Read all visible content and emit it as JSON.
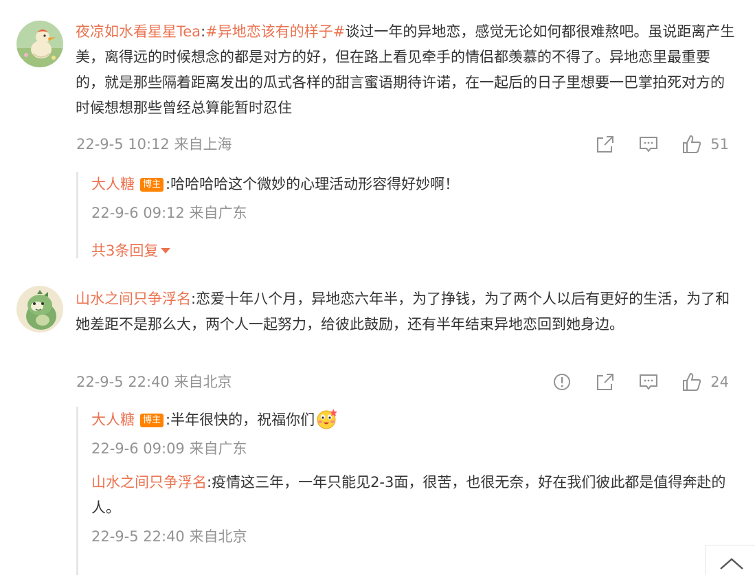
{
  "comments": [
    {
      "user": "夜凉如水看星星Tea",
      "sep": ":",
      "topic": "#异地恋该有的样子#",
      "text": "谈过一年的异地恋，感觉无论如何都很难熬吧。虽说距离产生美，离得远的时候想念的都是对方的好，但在路上看见牵手的情侣都羡慕的不得了。异地恋里最重要的，就是那些隔着距离发出的瓜式各样的甜言蜜语期待许诺，在一起后的日子里想要一巴掌拍死对方的时候想想那些曾经总算能暂时忍住",
      "time": "22-9-5 10:12 来自上海",
      "like_count": "51",
      "replies": [
        {
          "user": "大人糖",
          "badge": "博主",
          "text": ":哈哈哈哈这个微妙的心理活动形容得好妙啊！",
          "time": "22-9-6 09:12 来自广东"
        }
      ],
      "more_replies": "共3条回复"
    },
    {
      "user": "山水之间只争浮名",
      "sep": ":",
      "text": "恋爱十年八个月，异地恋六年半，为了挣钱，为了两个人以后有更好的生活，为了和她差距不是那么大，两个人一起努力，给彼此鼓励，还有半年结束异地恋回到她身边。",
      "time": "22-9-5 22:40 来自北京",
      "like_count": "24",
      "replies": [
        {
          "user": "大人糖",
          "badge": "博主",
          "text": ":半年很快的，祝福你们",
          "time": "22-9-6 09:09 来自广东"
        },
        {
          "user": "山水之间只争浮名",
          "text": ":疫情这三年，一年只能见2-3面，很苦，也很无奈，好在我们彼此都是值得奔赴的人。",
          "time": "22-9-5 22:40 来自北京"
        }
      ]
    }
  ],
  "icons": {
    "share": "share-icon",
    "comment": "comment-icon",
    "like": "thumbs-up-icon",
    "report": "report-icon",
    "back_to_top": "chevron-up-icon",
    "emoji": "blush-emoji-icon"
  },
  "colors": {
    "username": "#eb7350",
    "meta": "#939393",
    "badge": "#ff8200"
  }
}
